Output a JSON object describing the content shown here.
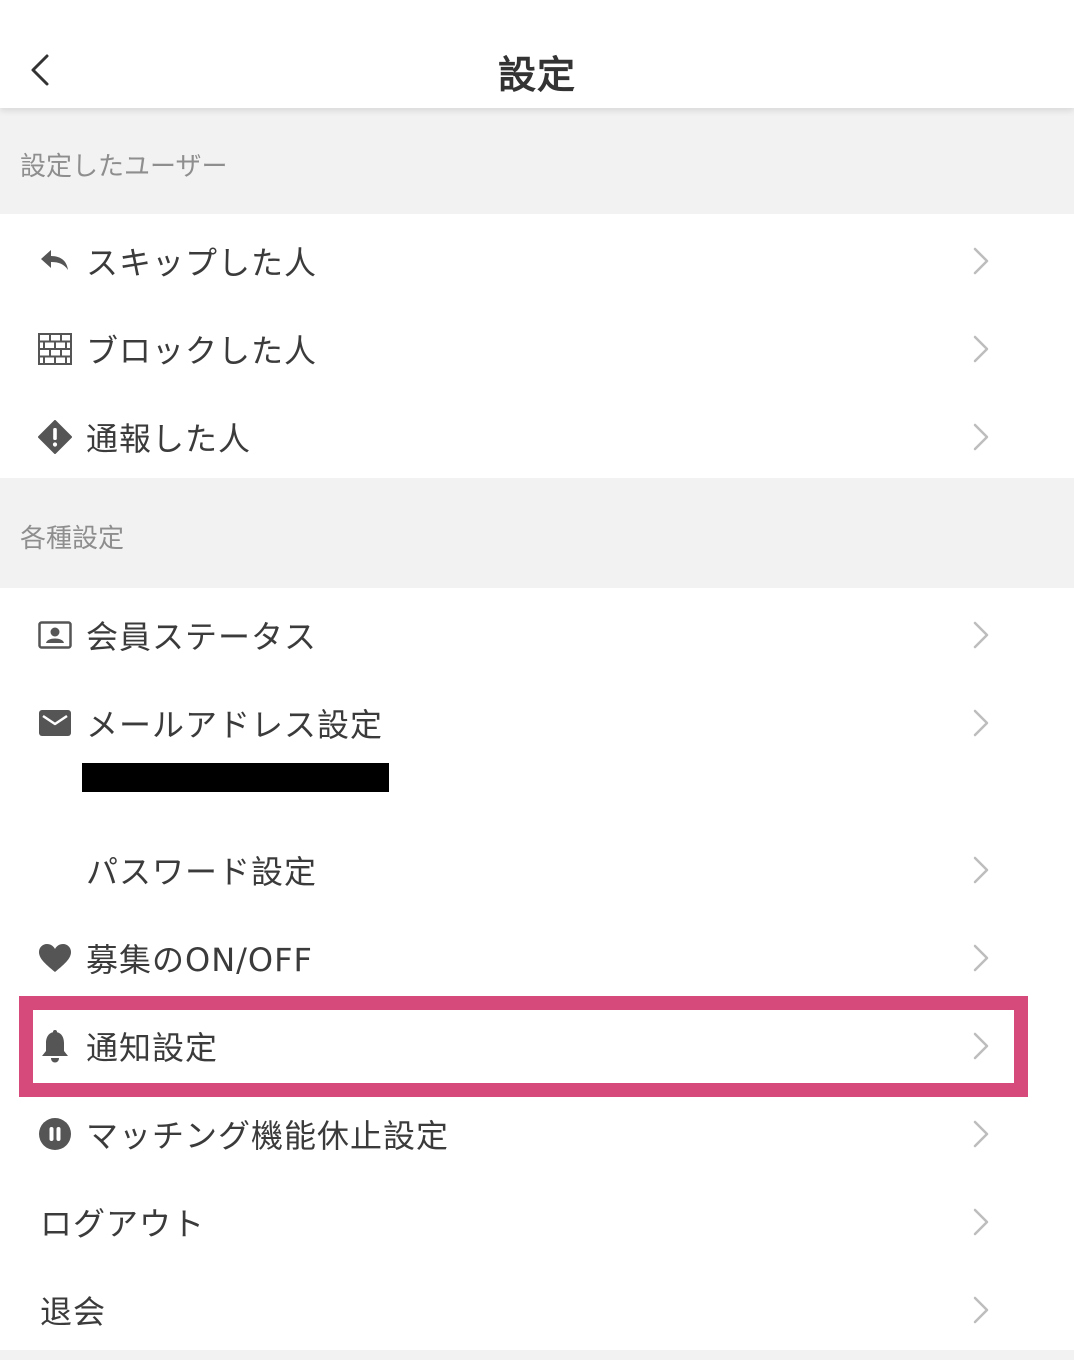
{
  "header": {
    "title": "設定"
  },
  "sections": {
    "users": {
      "label": "設定したユーザー"
    },
    "settings": {
      "label": "各種設定"
    }
  },
  "items": {
    "skipped": {
      "label": "スキップした人",
      "icon": "reply-icon"
    },
    "blocked": {
      "label": "ブロックした人",
      "icon": "brick-wall-icon"
    },
    "reported": {
      "label": "通報した人",
      "icon": "warning-diamond-icon"
    },
    "member_status": {
      "label": "会員ステータス",
      "icon": "id-card-icon"
    },
    "email": {
      "label": "メールアドレス設定",
      "icon": "envelope-icon"
    },
    "password": {
      "label": "パスワード設定"
    },
    "recruit": {
      "label": "募集のON/OFF",
      "icon": "heart-icon"
    },
    "notification": {
      "label": "通知設定",
      "icon": "bell-icon"
    },
    "matching_pause": {
      "label": "マッチング機能休止設定",
      "icon": "pause-circle-icon"
    },
    "logout": {
      "label": "ログアウト"
    },
    "withdraw": {
      "label": "退会"
    }
  },
  "colors": {
    "highlight": "#d6497b",
    "section_bg": "#f2f2f2",
    "icon": "#555555",
    "chevron": "#bdbdbd"
  }
}
